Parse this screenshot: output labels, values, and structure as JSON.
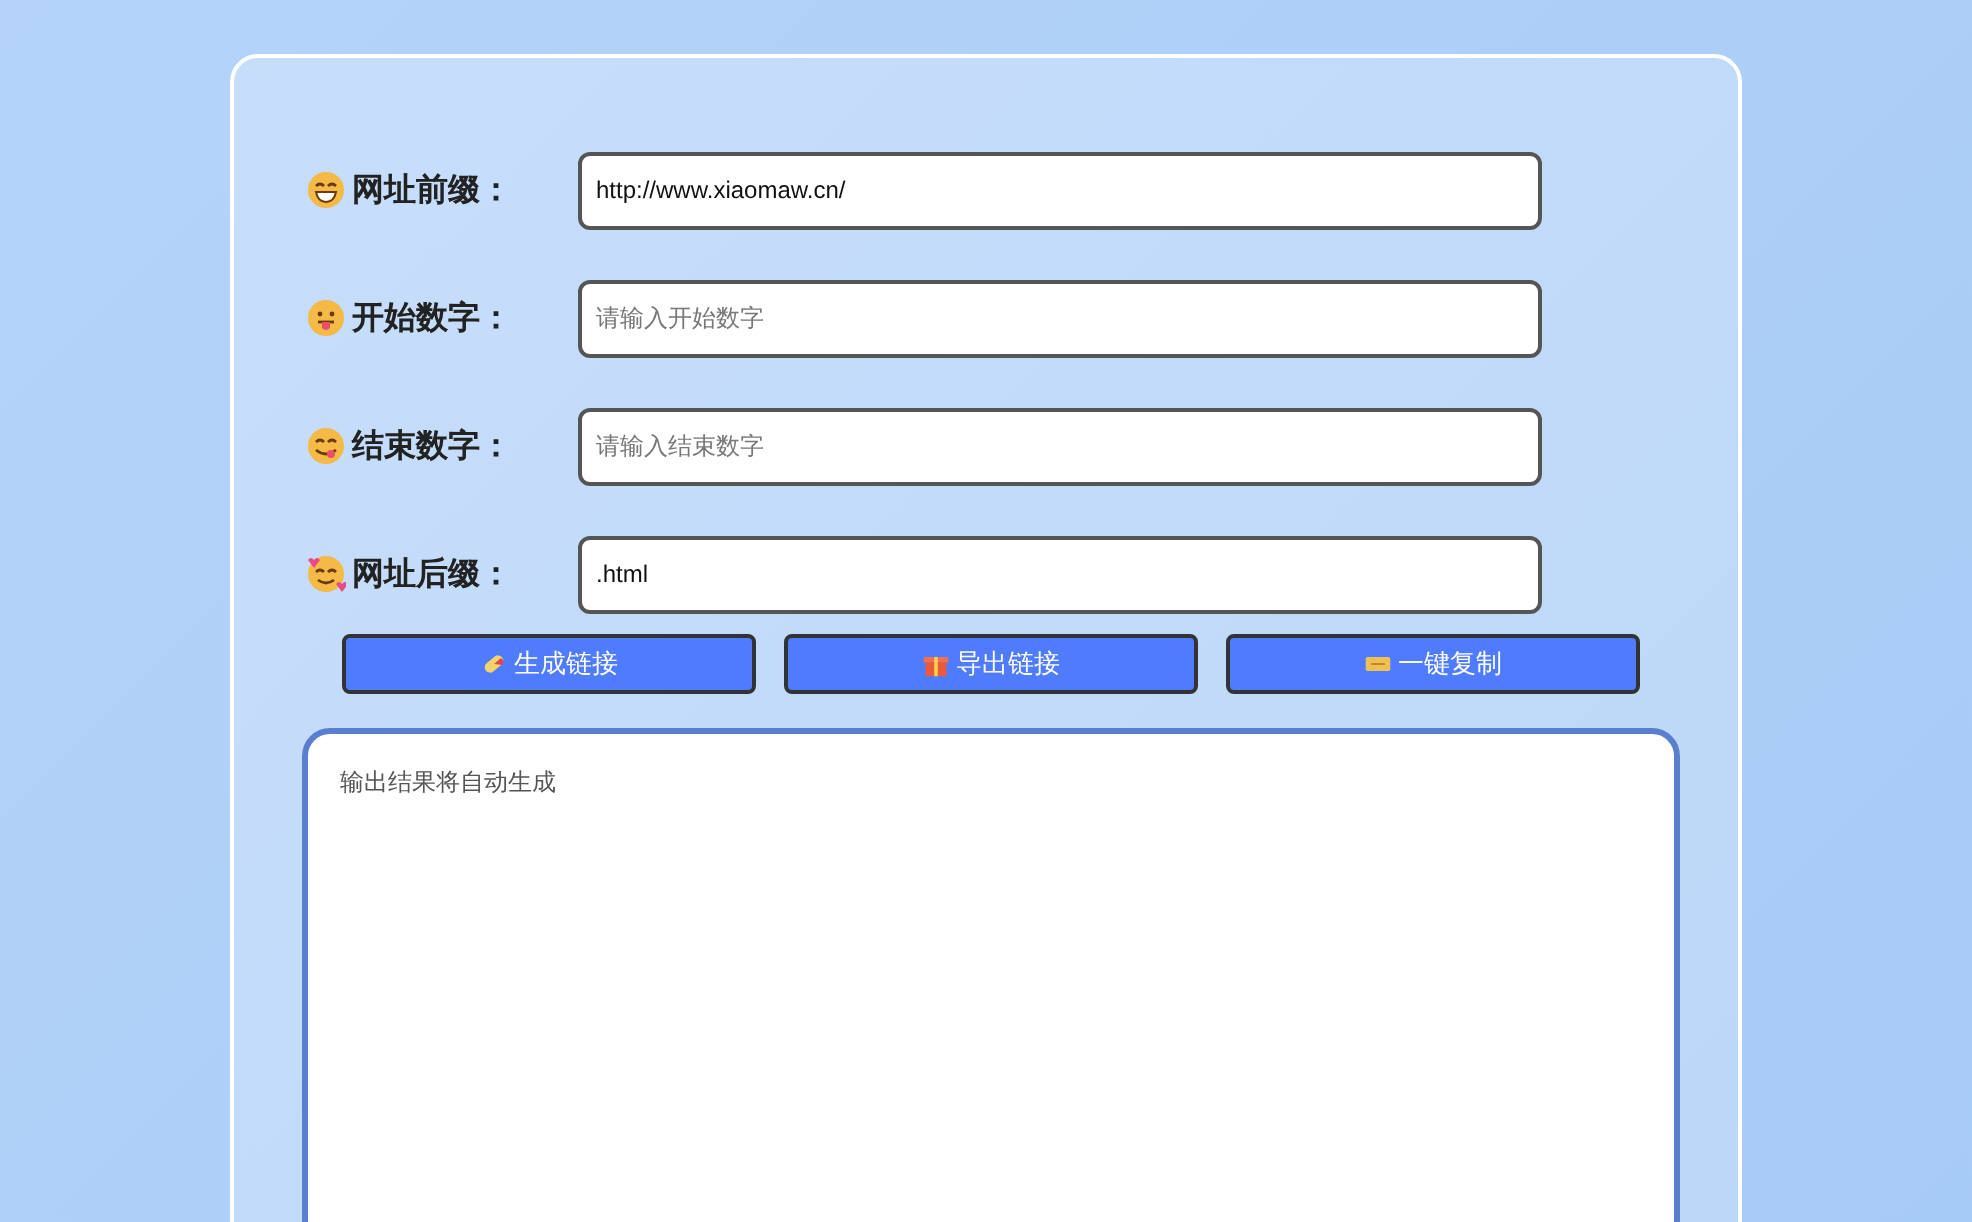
{
  "fields": [
    {
      "label": "网址前缀：",
      "value": "http://www.xiaomaw.cn/"
    },
    {
      "label": "开始数字：",
      "placeholder": "请输入开始数字"
    },
    {
      "label": "结束数字：",
      "placeholder": "请输入结束数字"
    },
    {
      "label": "网址后缀：",
      "value": ".html"
    }
  ],
  "buttons": [
    {
      "label": "生成链接"
    },
    {
      "label": "导出链接"
    },
    {
      "label": "一键复制"
    }
  ],
  "output": {
    "placeholder": "输出结果将自动生成"
  }
}
